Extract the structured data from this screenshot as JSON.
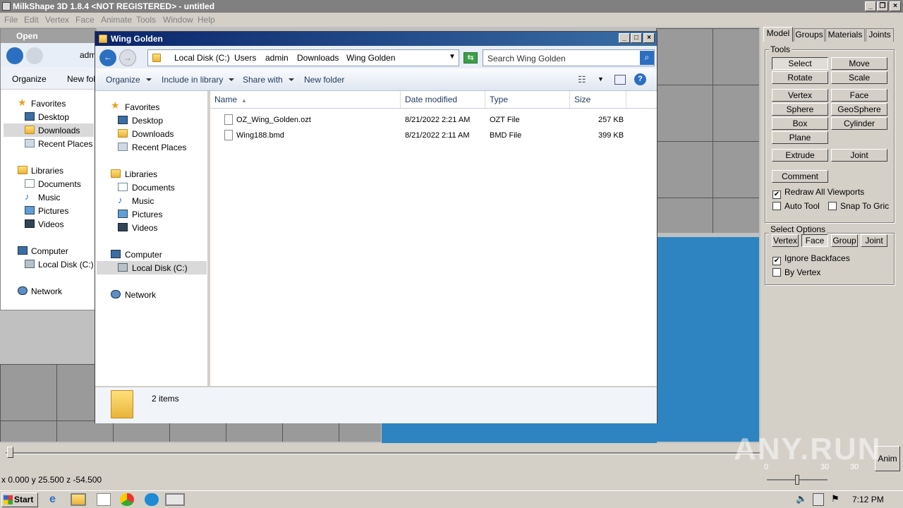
{
  "app": {
    "title": "MilkShape 3D 1.8.4 <NOT REGISTERED> - untitled",
    "menu": [
      "File",
      "Edit",
      "Vertex",
      "Face",
      "Animate",
      "Tools",
      "Window",
      "Help"
    ]
  },
  "panel": {
    "tabs": [
      "Model",
      "Groups",
      "Materials",
      "Joints"
    ],
    "tools_label": "Tools",
    "tool_buttons": [
      "Select",
      "Move",
      "Rotate",
      "Scale",
      "Vertex",
      "Face",
      "Sphere",
      "GeoSphere",
      "Box",
      "Cylinder",
      "Plane",
      "Extrude",
      "Joint",
      "Comment"
    ],
    "checks": [
      {
        "label": "Redraw All Viewports",
        "checked": true
      },
      {
        "label": "Auto Tool",
        "checked": false
      },
      {
        "label": "Snap To Gric",
        "checked": false
      }
    ],
    "select_options_label": "Select Options",
    "select_buttons": [
      "Vertex",
      "Face",
      "Group",
      "Joint"
    ],
    "select_checks": [
      {
        "label": "Ignore Backfaces",
        "checked": true
      },
      {
        "label": "By Vertex",
        "checked": false
      }
    ]
  },
  "timeline": {
    "anim_label": "Anim",
    "frame_start": "0",
    "frame_end": "30",
    "frame_total": "30"
  },
  "coords": "x 0.000 y 25.500 z -54.500",
  "open_dialog": {
    "title": "Open",
    "crumb": "adm",
    "organize": "Organize",
    "new_folder": "New fol",
    "nav": [
      "Favorites",
      "Desktop",
      "Downloads",
      "Recent Places",
      "Libraries",
      "Documents",
      "Music",
      "Pictures",
      "Videos",
      "Computer",
      "Local Disk (C:)",
      "Network"
    ]
  },
  "explorer": {
    "title": "Wing Golden",
    "breadcrumb": [
      "Local Disk (C:)",
      "Users",
      "admin",
      "Downloads",
      "Wing Golden"
    ],
    "search_placeholder": "Search Wing Golden",
    "toolbar": {
      "organize": "Organize",
      "include": "Include in library",
      "share": "Share with",
      "new_folder": "New folder"
    },
    "nav": [
      "Favorites",
      "Desktop",
      "Downloads",
      "Recent Places",
      "Libraries",
      "Documents",
      "Music",
      "Pictures",
      "Videos",
      "Computer",
      "Local Disk (C:)",
      "Network"
    ],
    "columns": [
      "Name",
      "Date modified",
      "Type",
      "Size"
    ],
    "files": [
      {
        "name": "OZ_Wing_Golden.ozt",
        "date": "8/21/2022 2:21 AM",
        "type": "OZT File",
        "size": "257 KB"
      },
      {
        "name": "Wing188.bmd",
        "date": "8/21/2022 2:11 AM",
        "type": "BMD File",
        "size": "399 KB"
      }
    ],
    "status": "2 items"
  },
  "taskbar": {
    "start": "Start",
    "time": "7:12 PM"
  },
  "colors": {
    "viewport_blue": "#2e84c0",
    "titlebar": "#0a246a",
    "grid": "#9a9a9a"
  }
}
